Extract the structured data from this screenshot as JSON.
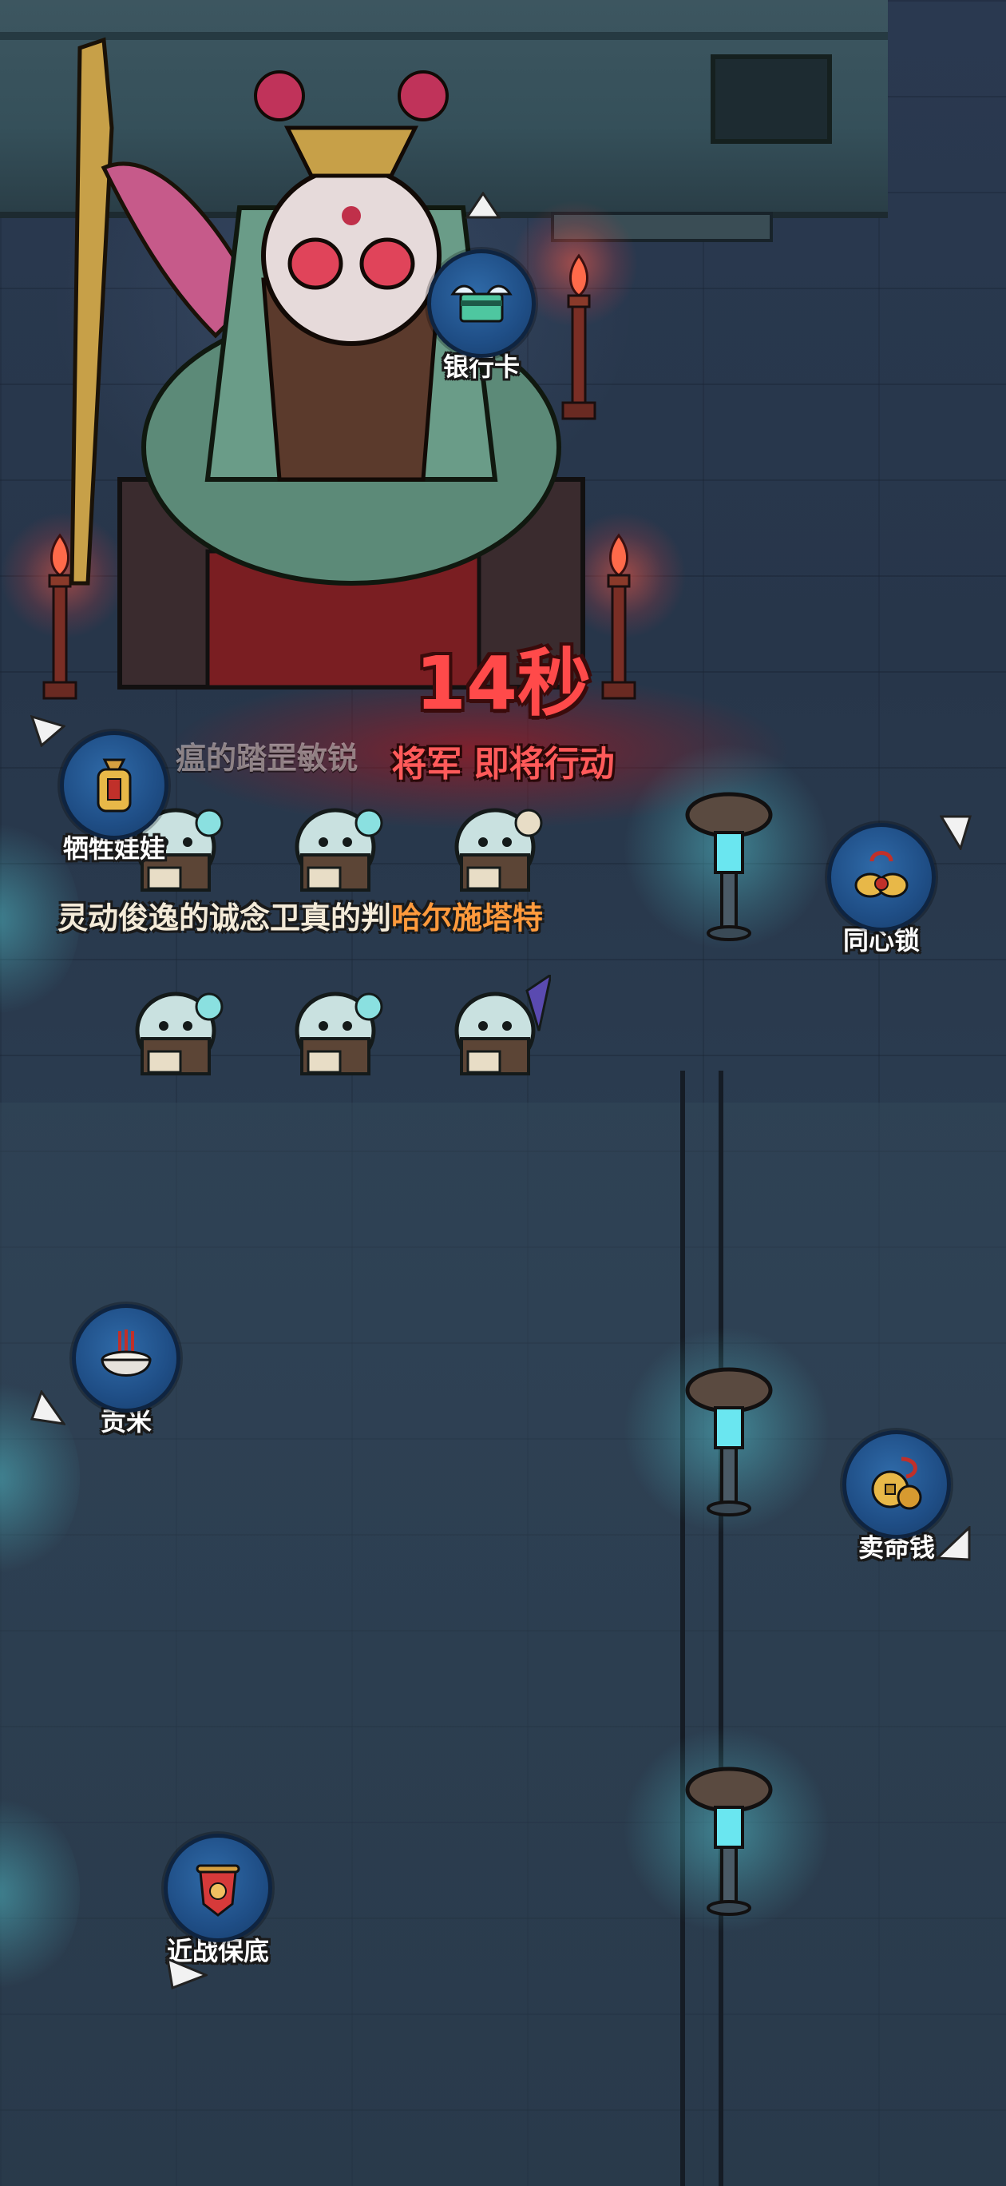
{
  "boss_alert": {
    "countdown": "14秒",
    "message": "将军 即将行动"
  },
  "captions": {
    "faded_fragment": "瘟的踏罡敏锐",
    "target_prefix": "灵动俊逸的诚念卫真的判",
    "target_name": "哈尔施塔特"
  },
  "items": [
    {
      "id": "bank-card",
      "label": "银行卡",
      "icon": "winged-bank-card-icon"
    },
    {
      "id": "sacrifice-doll",
      "label": "牺牲娃娃",
      "icon": "sacrifice-doll-icon"
    },
    {
      "id": "concentric-lock",
      "label": "同心锁",
      "icon": "concentric-lock-icon"
    },
    {
      "id": "tribute-rice",
      "label": "贡米",
      "icon": "rice-bowl-incense-icon"
    },
    {
      "id": "life-money",
      "label": "卖命钱",
      "icon": "gold-coin-pouch-icon"
    },
    {
      "id": "melee-guarantee",
      "label": "近战保底",
      "icon": "red-shield-scroll-icon"
    }
  ],
  "colors": {
    "badge_blue": "#1f4e86",
    "alert_red": "#ff4a4a",
    "name_orange": "#ff9a3c",
    "lamp_cyan": "#5adce6"
  }
}
